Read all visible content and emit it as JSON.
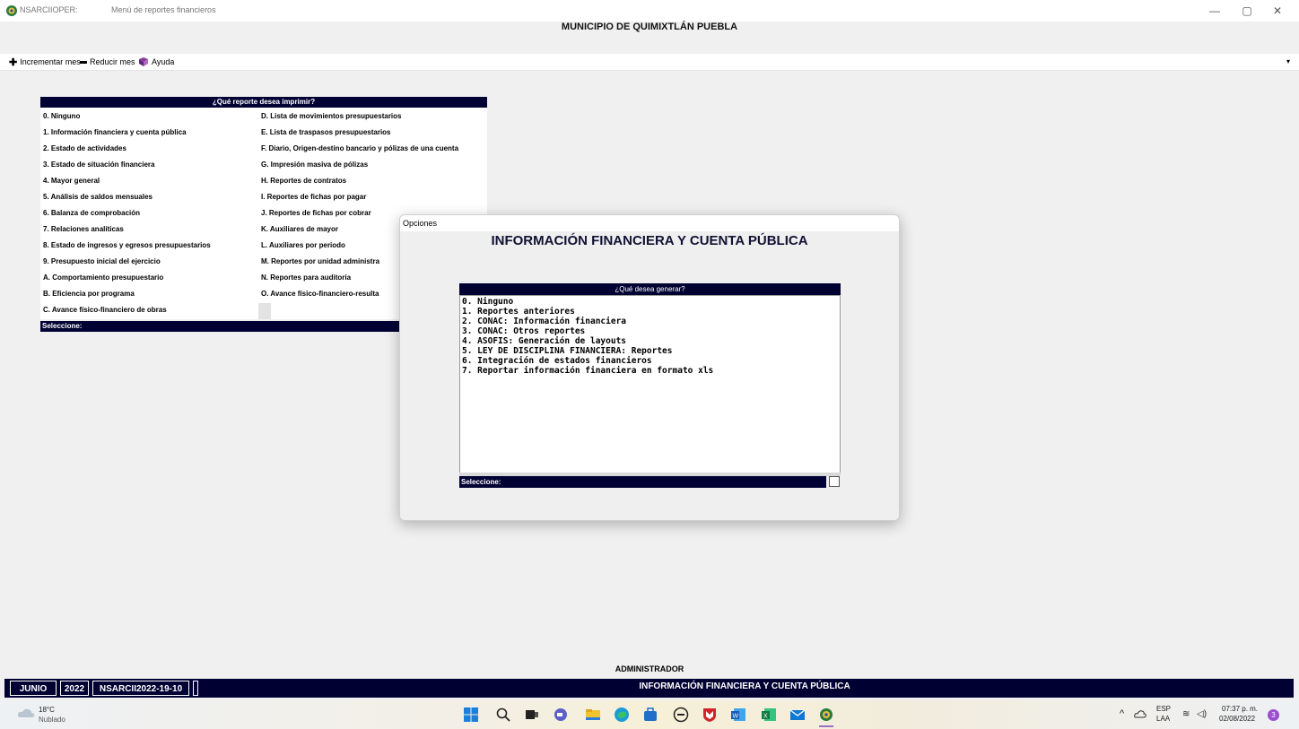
{
  "window": {
    "app_name": "NSARCIIOPER:",
    "title": "Menú de reportes financieros",
    "controls": [
      "—",
      "▢",
      "✕"
    ]
  },
  "header": {
    "municipio": "MUNICIPIO DE QUIMIXTLÁN PUEBLA"
  },
  "toolbar": {
    "increment_label": "Incrementar mes",
    "decrement_label": "Reducir mes",
    "help_label": "Ayuda",
    "more": "▾"
  },
  "report_menu": {
    "header": "¿Qué reporte desea imprimir?",
    "col1": [
      "0. Ninguno",
      "1. Información financiera y cuenta pública",
      "2. Estado de actividades",
      "3. Estado de situación financiera",
      "4. Mayor general",
      "5. Análisis de saldos mensuales",
      "6. Balanza de comprobación",
      "7. Relaciones analíticas",
      "8. Estado de ingresos y egresos presupuestarios",
      "9. Presupuesto inicial del ejercicio",
      "A. Comportamiento presupuestario",
      "B. Eficiencia por programa",
      "C. Avance físico-financiero de obras"
    ],
    "col2": [
      "D. Lista de movimientos presupuestarios",
      "E. Lista de traspasos presupuestarios",
      "F. Diario, Origen-destino bancario y pólizas de una cuenta",
      "G. Impresión masiva de pólizas",
      "H. Reportes de contratos",
      "I. Reportes de fichas por pagar",
      "J. Reportes de fichas por cobrar",
      "K. Auxiliares de mayor",
      "L. Auxiliares por periodo",
      "M. Reportes por unidad administra",
      "N. Reportes para auditoría",
      "O. Avance físico-financiero-resulta"
    ],
    "select_label": "Seleccione:"
  },
  "dialog": {
    "title": "Opciones",
    "heading": "INFORMACIÓN FINANCIERA Y CUENTA PÚBLICA",
    "list_header": "¿Qué desea generar?",
    "options": [
      "0. Ninguno",
      "1. Reportes anteriores",
      "2. CONAC: Información financiera",
      "3. CONAC: Otros reportes",
      "4. ASOFIS: Generación de layouts",
      "5. LEY DE DISCIPLINA FINANCIERA: Reportes",
      "6. Integración de estados financieros",
      "7. Reportar información financiera en formato xls"
    ],
    "select_label": "Seleccione:"
  },
  "footer": {
    "user": "ADMINISTRADOR",
    "month": "JUNIO",
    "year": "2022",
    "db": "NSARCII2022-19-10",
    "current_module": "INFORMACIÓN FINANCIERA Y CUENTA PÚBLICA"
  },
  "taskbar": {
    "weather_temp": "18°C",
    "weather_desc": "Nublado",
    "lang": "ESP",
    "layout": "LAA",
    "time": "07:37 p. m.",
    "date": "02/08/2022",
    "notif_count": "3",
    "tray_chevron": "^"
  },
  "colors": {
    "navy": "#000033",
    "background": "#f0f0f0"
  }
}
